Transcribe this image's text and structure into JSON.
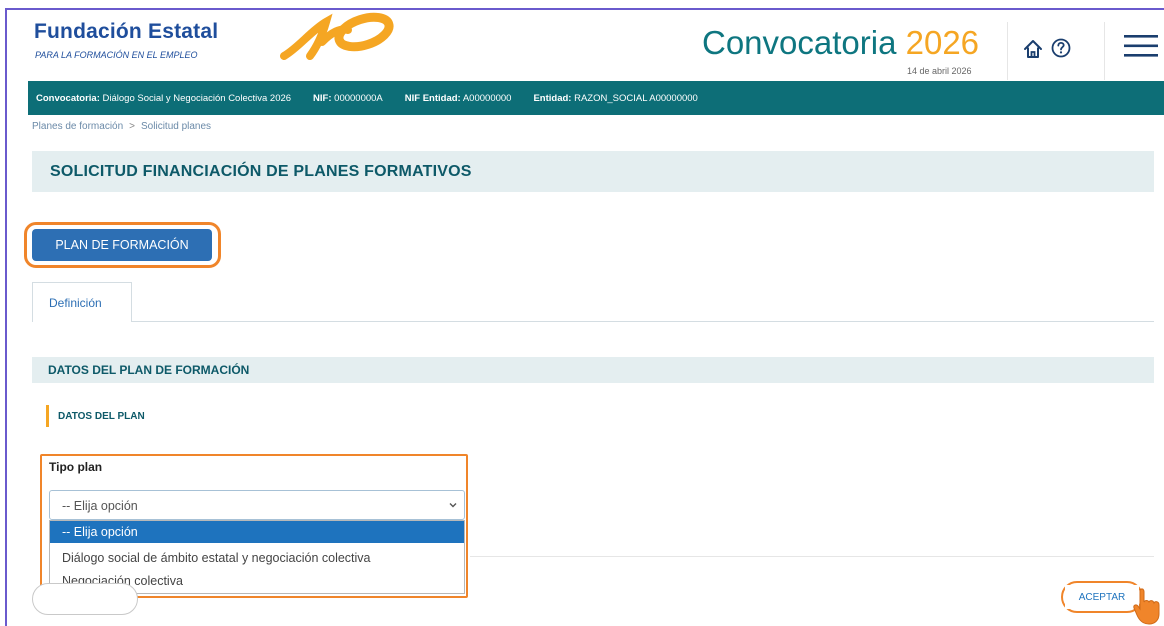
{
  "header": {
    "org_name": "Fundación Estatal",
    "org_subtitle": "PARA LA FORMACIÓN EN EL EMPLEO",
    "convocatoria_word": "Convocatoria",
    "convocatoria_year": "2026",
    "date": "14 de abril 2026",
    "icons": [
      "home-icon",
      "help-icon",
      "menu-icon"
    ],
    "brand_color": "#1f4e9c",
    "accent_color": "#f5a623",
    "teal_color": "#0e7680"
  },
  "infobar": {
    "convocatoria_label": "Convocatoria:",
    "convocatoria_value": "Diálogo Social y Negociación Colectiva 2026",
    "nif_label": "NIF:",
    "nif_value": "00000000A",
    "nif_entidad_label": "NIF Entidad:",
    "nif_entidad_value": "A00000000",
    "entidad_label": "Entidad:",
    "entidad_value": "RAZON_SOCIAL A00000000",
    "bg_color": "#0d6e77"
  },
  "breadcrumb": {
    "items": [
      "Planes de formación",
      "Solicitud planes"
    ],
    "separator": ">"
  },
  "page": {
    "title": "SOLICITUD FINANCIACIÓN DE PLANES FORMATIVOS",
    "plan_button": "PLAN DE FORMACIÓN",
    "tabs": [
      {
        "label": "Definición",
        "active": true
      }
    ],
    "section_title": "DATOS DEL PLAN DE FORMACIÓN",
    "subsection_title": "DATOS DEL PLAN"
  },
  "form": {
    "tipo_plan_label": "Tipo plan",
    "tipo_plan_value": "-- Elija opción",
    "options": [
      {
        "label": "-- Elija opción",
        "selected": true
      },
      {
        "label": "Diálogo social de ámbito estatal y negociación colectiva",
        "selected": false
      },
      {
        "label": "Negociación colectiva",
        "selected": false
      }
    ]
  },
  "footer": {
    "aceptar_label": "ACEPTAR",
    "highlight_color": "#f0852a"
  }
}
